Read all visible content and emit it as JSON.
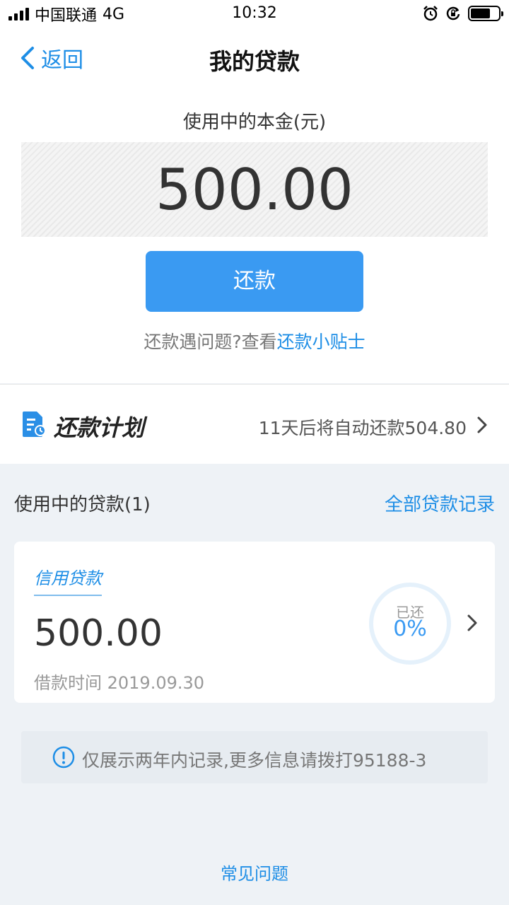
{
  "status_bar": {
    "carrier": "中国联通",
    "network": "4G",
    "time": "10:32"
  },
  "nav": {
    "back_label": "返回",
    "title": "我的贷款"
  },
  "principal": {
    "label": "使用中的本金(元)",
    "amount": "500.00"
  },
  "repay_button": "还款",
  "help": {
    "prefix": "还款遇问题?查看",
    "link": "还款小贴士"
  },
  "plan": {
    "title": "还款计划",
    "info": "11天后将自动还款504.80"
  },
  "loans": {
    "title": "使用中的贷款(1)",
    "all_records": "全部贷款记录"
  },
  "loan_card": {
    "type": "信用贷款",
    "amount": "500.00",
    "date": "借款时间 2019.09.30",
    "repaid_label": "已还",
    "repaid_percent": "0%",
    "repaid_fraction": 0
  },
  "notice": "仅展示两年内记录,更多信息请拨打95188-3",
  "faq": "常见问题",
  "colors": {
    "accent": "#1e8ee6",
    "button": "#3a9af2",
    "background": "#eef2f6"
  },
  "icons": [
    "signal-icon",
    "alarm-icon",
    "rotation-lock-icon",
    "battery-icon",
    "chevron-left-icon",
    "document-icon",
    "chevron-right-icon",
    "info-icon"
  ]
}
